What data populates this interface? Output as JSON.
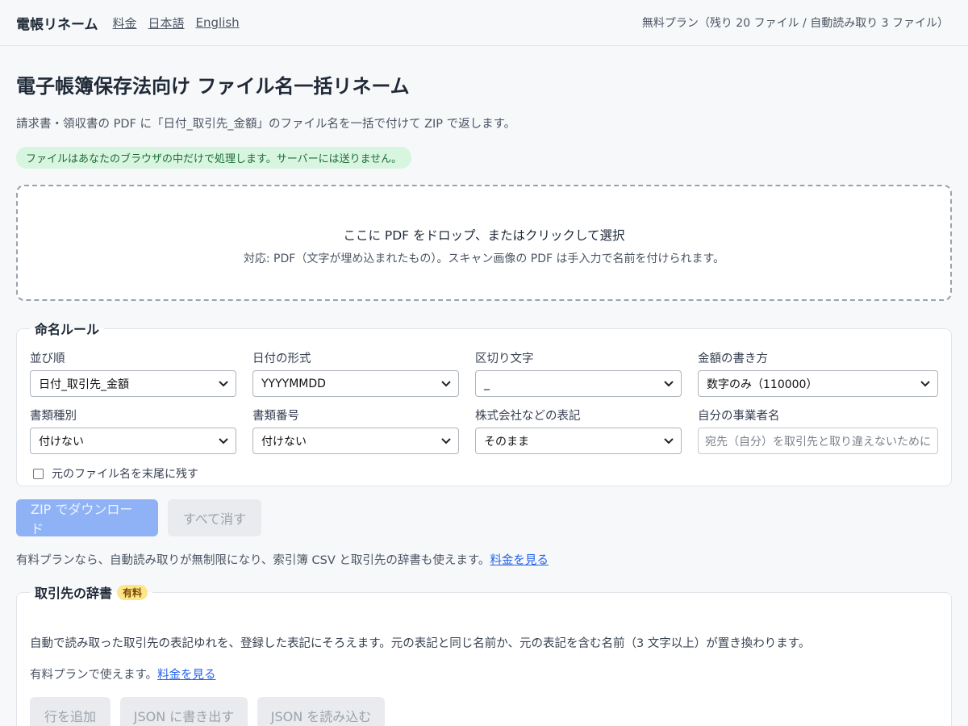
{
  "header": {
    "brand": "電帳リネーム",
    "nav": [
      "料金",
      "日本語",
      "English"
    ],
    "plan_status": "無料プラン（残り 20 ファイル / 自動読み取り 3 ファイル）"
  },
  "page": {
    "title": "電子帳簿保存法向け ファイル名一括リネーム",
    "lead": "請求書・領収書の PDF に「日付_取引先_金額」のファイル名を一括で付けて ZIP で返します。",
    "privacy_note": "ファイルはあなたのブラウザの中だけで処理します。サーバーには送りません。"
  },
  "dropzone": {
    "main": "ここに PDF をドロップ、またはクリックして選択",
    "sub": "対応: PDF（文字が埋め込まれたもの）。スキャン画像の PDF は手入力で名前を付けられます。"
  },
  "rules": {
    "legend": "命名ルール",
    "fields": [
      {
        "label": "並び順",
        "value": "日付_取引先_金額"
      },
      {
        "label": "日付の形式",
        "value": "YYYYMMDD"
      },
      {
        "label": "区切り文字",
        "value": "_"
      },
      {
        "label": "金額の書き方",
        "value": "数字のみ（110000）"
      },
      {
        "label": "書類種別",
        "value": "付けない"
      },
      {
        "label": "書類番号",
        "value": "付けない"
      },
      {
        "label": "株式会社などの表記",
        "value": "そのまま"
      },
      {
        "label": "自分の事業者名",
        "placeholder": "宛先（自分）を取引先と取り違えないために"
      }
    ],
    "keep_original_label": "元のファイル名を末尾に残す",
    "keep_original_checked": false
  },
  "actions": {
    "download": "ZIP でダウンロード",
    "clear": "すべて消す"
  },
  "upsell": {
    "text": "有料プランなら、自動読み取りが無制限になり、索引簿 CSV と取引先の辞書も使えます。",
    "link": "料金を見る"
  },
  "dictionary": {
    "legend": "取引先の辞書",
    "badge": "有料",
    "description": "自動で読み取った取引先の表記ゆれを、登録した表記にそろえます。元の表記と同じ名前か、元の表記を含む名前（3 文字以上）が置き換わります。",
    "note": "有料プランで使えます。",
    "note_link": "料金を見る",
    "buttons": [
      "行を追加",
      "JSON に書き出す",
      "JSON を読み込む"
    ]
  }
}
